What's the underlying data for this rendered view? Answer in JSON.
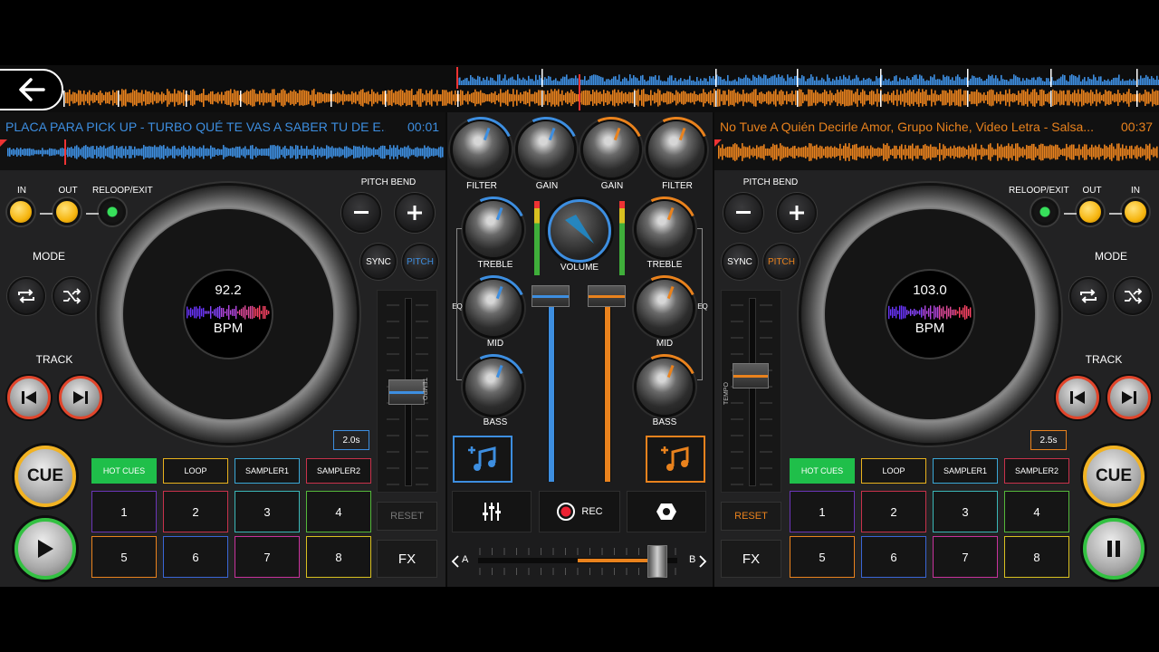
{
  "overview": {
    "back_icon": "arrow-left-icon"
  },
  "deck_a": {
    "title": "PLACA PARA PICK UP - TURBO  QUÉ TE VAS A SABER TU DE E...",
    "time": "00:01",
    "color": "#3d8ee0",
    "bpm_value": "92.2",
    "bpm_label": "BPM",
    "labels": {
      "in": "IN",
      "out": "OUT",
      "reloop": "RELOOP/EXIT",
      "mode": "MODE",
      "track": "TRACK",
      "pitch_bend": "PITCH BEND",
      "sync": "SYNC",
      "pitch": "PITCH",
      "tempo": "TEMPO",
      "reset": "RESET",
      "fx": "FX",
      "cue": "CUE"
    },
    "time_box": "2.0s",
    "tabs": [
      "HOT CUES",
      "LOOP",
      "SAMPLER1",
      "SAMPLER2"
    ],
    "pads": [
      "1",
      "2",
      "3",
      "4",
      "5",
      "6",
      "7",
      "8"
    ],
    "tempo_position": 0.5
  },
  "deck_b": {
    "title": "No Tuve A Quién Decirle Amor, Grupo Niche, Video Letra - Salsa...",
    "time": "00:37",
    "color": "#e9821d",
    "bpm_value": "103.0",
    "bpm_label": "BPM",
    "labels": {
      "in": "IN",
      "out": "OUT",
      "reloop": "RELOOP/EXIT",
      "mode": "MODE",
      "track": "TRACK",
      "pitch_bend": "PITCH BEND",
      "sync": "SYNC",
      "pitch": "PITCH",
      "tempo": "TEMPO",
      "reset": "RESET",
      "fx": "FX",
      "cue": "CUE"
    },
    "time_box": "2.5s",
    "tabs": [
      "HOT CUES",
      "LOOP",
      "SAMPLER1",
      "SAMPLER2"
    ],
    "pads": [
      "1",
      "2",
      "3",
      "4",
      "5",
      "6",
      "7",
      "8"
    ],
    "tempo_position": 0.4
  },
  "mixer": {
    "labels": {
      "filter": "FILTER",
      "gain": "GAIN",
      "treble": "TREBLE",
      "mid": "MID",
      "bass": "BASS",
      "volume": "VOLUME",
      "eq": "EQ",
      "rec": "REC",
      "a": "A",
      "b": "B"
    },
    "channel_a_level": 1.0,
    "channel_b_level": 1.0,
    "crossfader_position": 0.9
  },
  "colors": {
    "blue": "#3d8ee0",
    "orange": "#e9821d",
    "hotcue_green": "#1fbf4a",
    "pad_colors": [
      "#6b35b8",
      "#c8324b",
      "#3ab7b7",
      "#54b83a",
      "#e9821d",
      "#3a66d6",
      "#c8329c",
      "#d8c020"
    ]
  }
}
